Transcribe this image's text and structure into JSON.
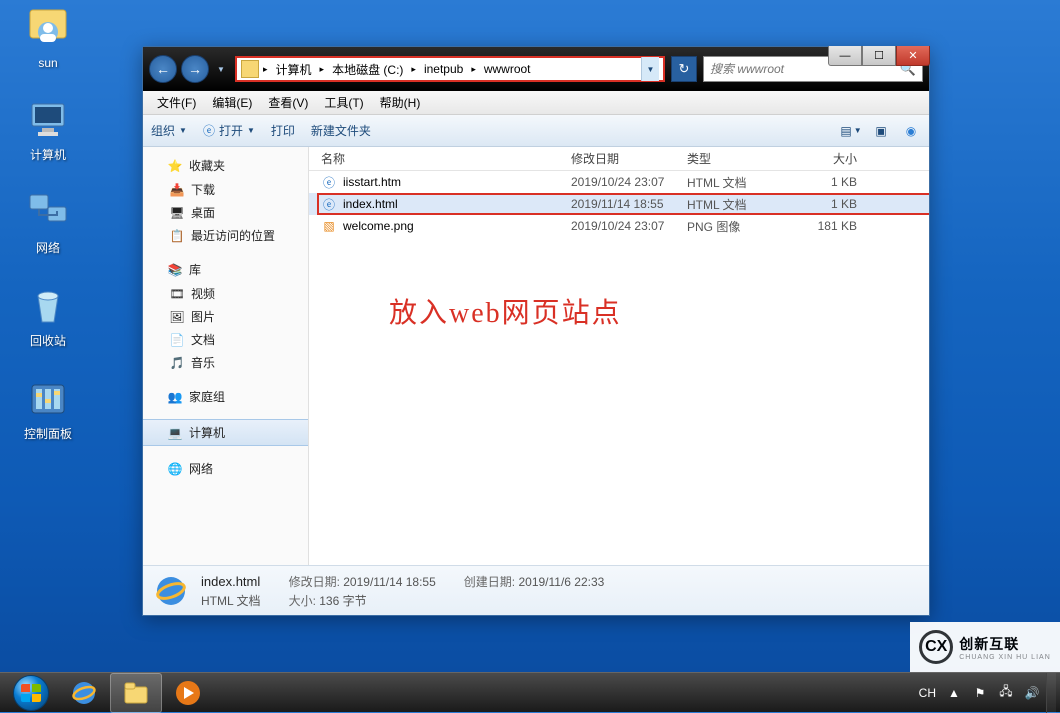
{
  "desktop": {
    "icons": [
      {
        "name": "sun-user-icon",
        "label": "sun"
      },
      {
        "name": "computer-icon",
        "label": "计算机"
      },
      {
        "name": "network-icon",
        "label": "网络"
      },
      {
        "name": "recycle-bin-icon",
        "label": "回收站"
      },
      {
        "name": "control-panel-icon",
        "label": "控制面板"
      }
    ]
  },
  "window": {
    "breadcrumb": [
      "计算机",
      "本地磁盘 (C:)",
      "inetpub",
      "wwwroot"
    ],
    "search_placeholder": "搜索 wwwroot",
    "menubar": [
      "文件(F)",
      "编辑(E)",
      "查看(V)",
      "工具(T)",
      "帮助(H)"
    ],
    "toolbar": {
      "organise": "组织",
      "open": "打开",
      "print": "打印",
      "new_folder": "新建文件夹"
    },
    "columns": {
      "name": "名称",
      "date": "修改日期",
      "type": "类型",
      "size": "大小"
    },
    "files": [
      {
        "icon": "ie-icon",
        "name": "iisstart.htm",
        "date": "2019/10/24 23:07",
        "type": "HTML 文档",
        "size": "1 KB",
        "selected": false
      },
      {
        "icon": "ie-icon",
        "name": "index.html",
        "date": "2019/11/14 18:55",
        "type": "HTML 文档",
        "size": "1 KB",
        "selected": true
      },
      {
        "icon": "png-icon",
        "name": "welcome.png",
        "date": "2019/10/24 23:07",
        "type": "PNG 图像",
        "size": "181 KB",
        "selected": false
      }
    ],
    "annotation": "放入web网页站点",
    "details": {
      "filename": "index.html",
      "filetype": "HTML 文档",
      "mod_label": "修改日期:",
      "mod_value": "2019/11/14 18:55",
      "size_label": "大小:",
      "size_value": "136 字节",
      "create_label": "创建日期:",
      "create_value": "2019/11/6 22:33"
    },
    "sidebar": {
      "favourites": {
        "header": "收藏夹",
        "items": [
          "下载",
          "桌面",
          "最近访问的位置"
        ]
      },
      "libraries": {
        "header": "库",
        "items": [
          "视频",
          "图片",
          "文档",
          "音乐"
        ]
      },
      "homegroup": {
        "header": "家庭组"
      },
      "computer": {
        "header": "计算机"
      },
      "network": {
        "header": "网络"
      }
    }
  },
  "taskbar": {
    "ime": "CH"
  },
  "watermark": {
    "brand": "创新互联",
    "sub": "CHUANG XIN HU LIAN"
  }
}
